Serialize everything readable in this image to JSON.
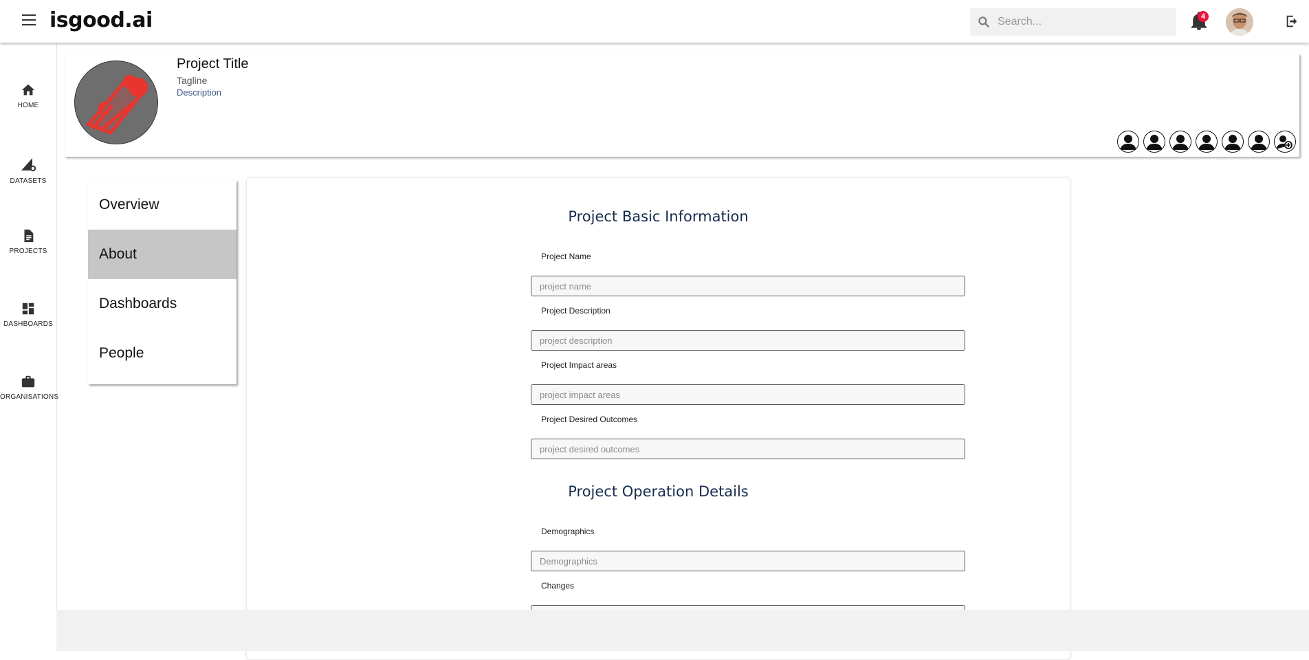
{
  "app": {
    "logo": "isgood.ai"
  },
  "topbar": {
    "search_placeholder": "Search...",
    "notification_count": "4"
  },
  "nav": [
    {
      "label": "HOME",
      "icon": "home-icon"
    },
    {
      "label": "DATASETS",
      "icon": "datasets-icon"
    },
    {
      "label": "PROJECTS",
      "icon": "document-icon"
    },
    {
      "label": "DASHBOARDS",
      "icon": "dashboard-icon"
    },
    {
      "label": "ORGANISATIONS",
      "icon": "briefcase-icon"
    }
  ],
  "project": {
    "title": "Project Title",
    "tagline": "Tagline",
    "description": "Description"
  },
  "tabs": [
    {
      "label": "Overview",
      "active": false
    },
    {
      "label": "About",
      "active": true
    },
    {
      "label": "Dashboards",
      "active": false
    },
    {
      "label": "People",
      "active": false
    }
  ],
  "form": {
    "section1_title": "Project Basic Information",
    "section2_title": "Project Operation Details",
    "fields": [
      {
        "label": "Project Name",
        "placeholder": "project name"
      },
      {
        "label": "Project Description",
        "placeholder": "project description"
      },
      {
        "label": "Project Impact areas",
        "placeholder": "project impact areas"
      },
      {
        "label": "Project Desired Outcomes",
        "placeholder": "project desired outcomes"
      },
      {
        "label": "Demographics",
        "placeholder": "Demographics"
      },
      {
        "label": "Changes",
        "placeholder": ""
      }
    ]
  },
  "colors": {
    "active_tab": "#c6c6c6",
    "badge": "#e8143c",
    "logo_red": "#e8352e",
    "section_title": "#172b4d"
  }
}
